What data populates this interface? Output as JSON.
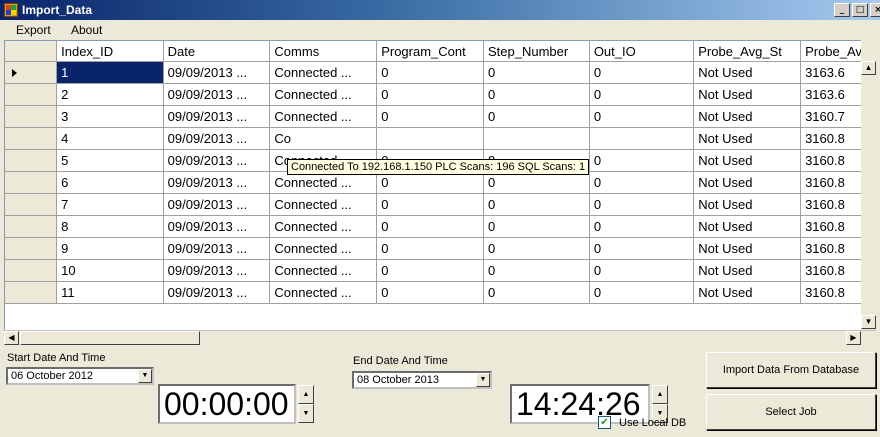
{
  "window": {
    "title": "Import_Data",
    "buttons": [
      "_",
      "□",
      "×"
    ]
  },
  "menu": [
    {
      "label": "Export"
    },
    {
      "label": "About"
    }
  ],
  "grid": {
    "columns": [
      "Index_ID",
      "Date",
      "Comms",
      "Program_Cont",
      "Step_Number",
      "Out_IO",
      "Probe_Avg_St",
      "Probe_Av"
    ],
    "rows": [
      [
        "1",
        "09/09/2013 ...",
        "Connected ...",
        "0",
        "0",
        "0",
        "Not Used",
        "3163.6"
      ],
      [
        "2",
        "09/09/2013 ...",
        "Connected ...",
        "0",
        "0",
        "0",
        "Not Used",
        "3163.6"
      ],
      [
        "3",
        "09/09/2013 ...",
        "Connected ...",
        "0",
        "0",
        "0",
        "Not Used",
        "3160.7"
      ],
      [
        "4",
        "09/09/2013 ...",
        "Co",
        "",
        "",
        "",
        "Not Used",
        "3160.8"
      ],
      [
        "5",
        "09/09/2013 ...",
        "Connected ...",
        "0",
        "0",
        "0",
        "Not Used",
        "3160.8"
      ],
      [
        "6",
        "09/09/2013 ...",
        "Connected ...",
        "0",
        "0",
        "0",
        "Not Used",
        "3160.8"
      ],
      [
        "7",
        "09/09/2013 ...",
        "Connected ...",
        "0",
        "0",
        "0",
        "Not Used",
        "3160.8"
      ],
      [
        "8",
        "09/09/2013 ...",
        "Connected ...",
        "0",
        "0",
        "0",
        "Not Used",
        "3160.8"
      ],
      [
        "9",
        "09/09/2013 ...",
        "Connected ...",
        "0",
        "0",
        "0",
        "Not Used",
        "3160.8"
      ],
      [
        "10",
        "09/09/2013 ...",
        "Connected ...",
        "0",
        "0",
        "0",
        "Not Used",
        "3160.8"
      ],
      [
        "11",
        "09/09/2013 ...",
        "Connected ...",
        "0",
        "0",
        "0",
        "Not Used",
        "3160.8"
      ]
    ],
    "selected_row": 0,
    "tooltip": "Connected To 192.168.1.150  PLC Scans: 196  SQL Scans: 1"
  },
  "controls": {
    "start_label": "Start Date And Time",
    "start_date": "06  October  2012",
    "start_time": "00:00:00",
    "end_label": "End Date And Time",
    "end_date": "08  October  2013",
    "end_time": "14:24:26",
    "import_button": "Import Data From Database",
    "select_job_button": "Select Job",
    "use_local_db_label": "Use Local DB",
    "use_local_db_checked": true
  },
  "icons": {
    "row_pointer": "arrow-right-icon",
    "dropdown": "chevron-down-icon",
    "spin_up": "triangle-up-icon",
    "spin_down": "triangle-down-icon"
  }
}
